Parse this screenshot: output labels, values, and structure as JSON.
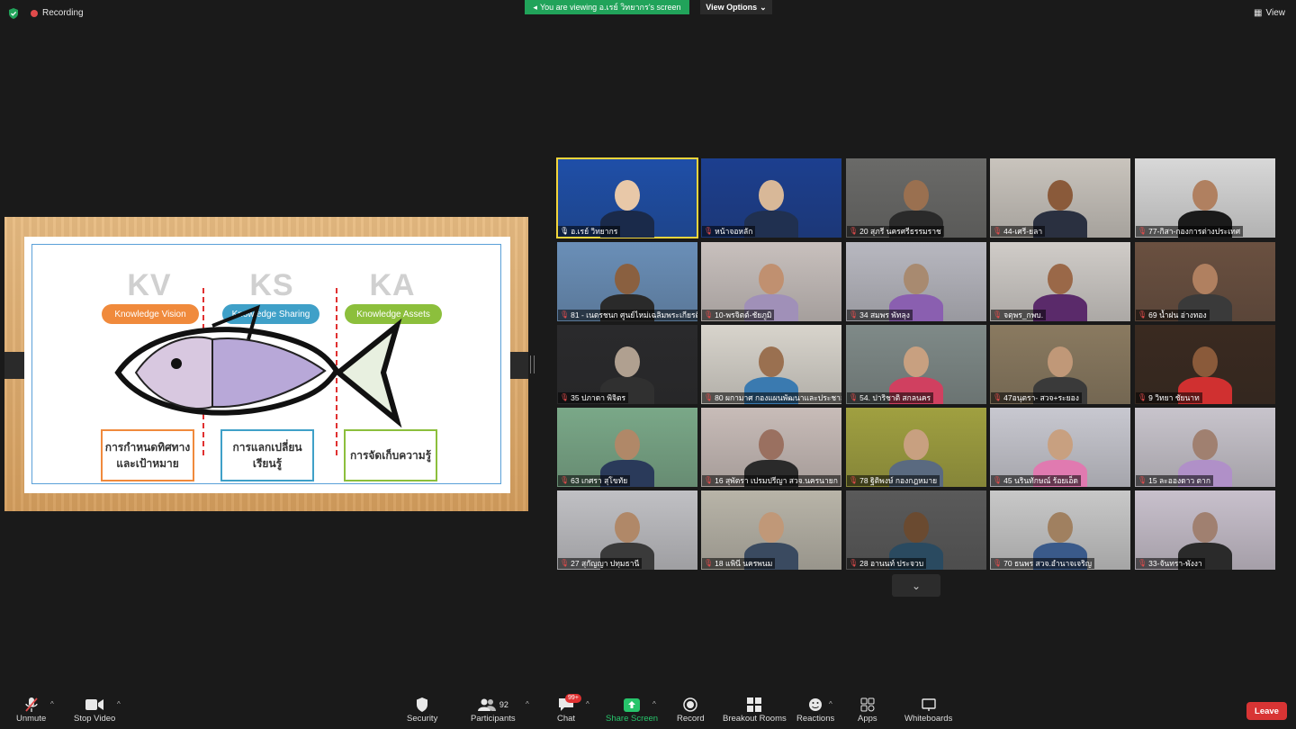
{
  "topbar": {
    "recording": "Recording",
    "viewing_banner": "You are viewing อ.เรย์ วิทยากร's screen",
    "view_options": "View Options",
    "view": "View"
  },
  "slide": {
    "kv": "KV",
    "ks": "KS",
    "ka": "KA",
    "kv_pill": "Knowledge Vision",
    "ks_pill": "Knowledge Sharing",
    "ka_pill": "Knowledge Assets",
    "box1": "การกำหนดทิศทาง และเป้าหมาย",
    "box2": "การแลกเปลี่ยน เรียนรู้",
    "box3": "การจัดเก็บความรู้",
    "colors": {
      "kv": "#f08a3c",
      "ks": "#3fa0c8",
      "ka": "#8cbf3c"
    }
  },
  "participants": [
    {
      "name": "อ.เรย์ วิทยากร",
      "bg": "#1f4fa8",
      "skin": "#e8c8a8",
      "shirt": "#1a2a4a",
      "muted": false
    },
    {
      "name": "หน้าจอหลัก",
      "bg": "#1c3f8f",
      "skin": "#d8b898",
      "shirt": "#203050",
      "muted": true
    },
    {
      "name": "20 สุภรี นครศรีธรรมราช",
      "bg": "#6a6a68",
      "skin": "#9a7050",
      "shirt": "#2a2a2a",
      "muted": true
    },
    {
      "name": "44-เศรี-ยลา",
      "bg": "#c9c4bd",
      "skin": "#8a5a3a",
      "shirt": "#2a3040",
      "muted": true
    },
    {
      "name": "77-กิสา-กองการต่างประเทศ",
      "bg": "#d8d8d8",
      "skin": "#b08060",
      "shirt": "#1a1a1a",
      "muted": true
    },
    {
      "name": "81 - เนตรชนก ศูนย์ไหม่เฉลิมพระเกียรติฯ",
      "bg": "#6a8fb8",
      "skin": "#8a6040",
      "shirt": "#2a2a2a",
      "muted": true
    },
    {
      "name": "10-พรจิตต์-ชัยภูมิ",
      "bg": "#c8c0bd",
      "skin": "#c09070",
      "shirt": "#a090b8",
      "muted": true
    },
    {
      "name": "34 สมพร พัทลุง",
      "bg": "#b8b8c0",
      "skin": "#a88a70",
      "shirt": "#8a5fb0",
      "muted": true
    },
    {
      "name": "จตุพร_กพบ.",
      "bg": "#d0ccc8",
      "skin": "#9a6848",
      "shirt": "#5a2a6a",
      "muted": true
    },
    {
      "name": "69 น้ำฝน อ่างทอง",
      "bg": "#6a5040",
      "skin": "#b08060",
      "shirt": "#3a3a3a",
      "muted": true
    },
    {
      "name": "35 ปภาดา พิจิตร",
      "bg": "#2a2a2c",
      "skin": "#b0a090",
      "shirt": "#303030",
      "muted": true
    },
    {
      "name": "80 ผกามาศ กองแผนพัฒนาและประชาสัมพันธ์",
      "bg": "#d8d4cc",
      "skin": "#9a7050",
      "shirt": "#3a7ab0",
      "muted": true
    },
    {
      "name": "54. ปาริชาติ สกลนคร",
      "bg": "#7f8a88",
      "skin": "#c8a080",
      "shirt": "#d04060",
      "muted": true
    },
    {
      "name": "47อนุตรา- สวจ+ระยอง",
      "bg": "#8a7a60",
      "skin": "#c09878",
      "shirt": "#3a3a3a",
      "muted": true
    },
    {
      "name": "9 วิทยา ชัยนาท",
      "bg": "#3a2a20",
      "skin": "#8a5a3a",
      "shirt": "#d03030",
      "muted": true
    },
    {
      "name": "63 เกศรา สุโขทัย",
      "bg": "#7aa888",
      "skin": "#b08868",
      "shirt": "#2a3a5a",
      "muted": true
    },
    {
      "name": "16 สุพัตรา เปรมปรีญา สวจ.นครนายก",
      "bg": "#c8bcb8",
      "skin": "#9a7060",
      "shirt": "#2a2a2a",
      "muted": true
    },
    {
      "name": "78 ฐิติพงษ์ กองกฎหมาย",
      "bg": "#a0a040",
      "skin": "#c8a080",
      "shirt": "#5a6a80",
      "muted": true
    },
    {
      "name": "45 นรินทักษณ์ ร้อยเอ็ด",
      "bg": "#c8c8d0",
      "skin": "#c8a080",
      "shirt": "#e07ab0",
      "muted": true
    },
    {
      "name": "15 ละอองดาว ตาก",
      "bg": "#c8c4cc",
      "skin": "#a08070",
      "shirt": "#b090c8",
      "muted": true
    },
    {
      "name": "27 สุกัญญา ปทุมธานี",
      "bg": "#c0c0c4",
      "skin": "#b08868",
      "shirt": "#3a3a3a",
      "muted": true
    },
    {
      "name": "18 แพินี นครพนม",
      "bg": "#b8b4a8",
      "skin": "#c09878",
      "shirt": "#3a4a60",
      "muted": true
    },
    {
      "name": "28 อานนท์ ประจวบ",
      "bg": "#5a5a5a",
      "skin": "#6a4a30",
      "shirt": "#2a4a60",
      "muted": true
    },
    {
      "name": "70 ธนพร สวจ.อำนาจเจริญ",
      "bg": "#c8c8c8",
      "skin": "#a08060",
      "shirt": "#3a5a8a",
      "muted": true
    },
    {
      "name": "33-จันทรา-พังงา",
      "bg": "#c8c0cc",
      "skin": "#a08070",
      "shirt": "#2a2a2a",
      "muted": true
    }
  ],
  "toolbar": {
    "unmute": "Unmute",
    "stop_video": "Stop Video",
    "security": "Security",
    "participants": "Participants",
    "participant_count": "92",
    "chat": "Chat",
    "chat_badge": "99+",
    "share_screen": "Share Screen",
    "record": "Record",
    "breakout": "Breakout Rooms",
    "reactions": "Reactions",
    "apps": "Apps",
    "whiteboards": "Whiteboards",
    "leave": "Leave"
  }
}
